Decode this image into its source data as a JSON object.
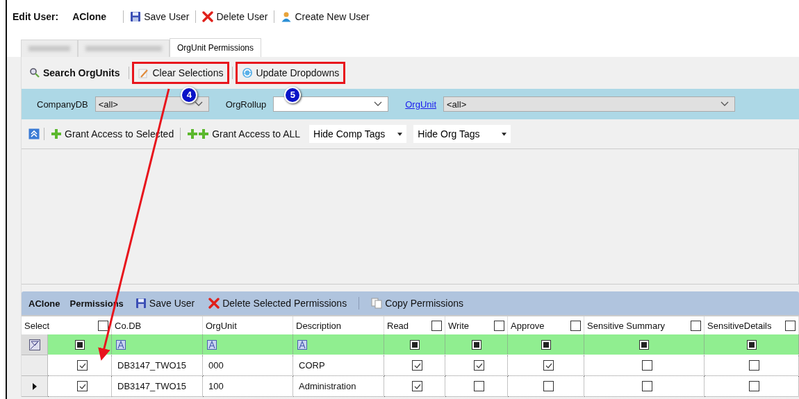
{
  "header": {
    "label": "Edit User:",
    "user": "AClone"
  },
  "toolbar": [
    {
      "kind": "save",
      "label": "Save User"
    },
    {
      "kind": "delete",
      "label": "Delete User"
    },
    {
      "kind": "new-user",
      "label": "Create New User"
    }
  ],
  "tabs": [
    {
      "kind": "blurred",
      "selected": false
    },
    {
      "kind": "blurred",
      "selected": false
    },
    {
      "kind": "text",
      "label": "OrgUnit Permissions",
      "selected": true
    }
  ],
  "search_toolbar": [
    {
      "kind": "search",
      "label": "Search OrgUnits"
    },
    {
      "kind": "clear",
      "label": "Clear Selections",
      "callout": "4"
    },
    {
      "kind": "refresh",
      "label": "Update Dropdowns",
      "callout": "5"
    }
  ],
  "filters": [
    {
      "label": "CompanyDB",
      "value": "<all>",
      "link": false,
      "disabled": true
    },
    {
      "label": "OrgRollup",
      "link": false,
      "disabled": false
    },
    {
      "label": "OrgUnit",
      "value": "<all>",
      "link": true,
      "disabled": true
    }
  ],
  "action_toolbar": [
    {
      "kind": "collapse"
    },
    {
      "kind": "grant",
      "label": "Grant Access to Selected"
    },
    {
      "kind": "grant-all",
      "label": "Grant Access to ALL"
    },
    {
      "kind": "dropdown",
      "label": "Hide Comp Tags"
    },
    {
      "kind": "dropdown",
      "label": "Hide Org Tags"
    }
  ],
  "permissions": {
    "user": "AClone",
    "title": "Permissions",
    "buttons": [
      {
        "kind": "save",
        "label": "Save User"
      },
      {
        "kind": "delete",
        "label": "Delete Selected Permissions"
      },
      {
        "kind": "copy",
        "label": "Copy Permissions"
      }
    ]
  },
  "grid": {
    "columns": [
      {
        "label": "Select",
        "kind": "check",
        "header_checked": false,
        "filter_indeterminate": true
      },
      {
        "label": "Co.DB",
        "kind": "text"
      },
      {
        "label": "OrgUnit",
        "kind": "text"
      },
      {
        "label": "Description",
        "kind": "text"
      },
      {
        "label": "Read",
        "kind": "check",
        "header_checked": false,
        "filter_indeterminate": true
      },
      {
        "label": "Write",
        "kind": "check",
        "header_checked": false,
        "filter_indeterminate": true
      },
      {
        "label": "Approve",
        "kind": "check",
        "header_checked": false,
        "filter_indeterminate": true
      },
      {
        "label": "Sensitive Summary",
        "kind": "check",
        "header_checked": false,
        "filter_indeterminate": true
      },
      {
        "label": "SensitiveDetails",
        "kind": "check",
        "header_checked": false,
        "filter_indeterminate": true
      }
    ],
    "rows": [
      {
        "current": false,
        "cells": [
          true,
          "DB3147_TWO15",
          "000",
          "CORP",
          true,
          true,
          true,
          false,
          false
        ]
      },
      {
        "current": true,
        "cells": [
          true,
          "DB3147_TWO15",
          "100",
          "Administration",
          true,
          false,
          false,
          false,
          false
        ]
      }
    ]
  }
}
